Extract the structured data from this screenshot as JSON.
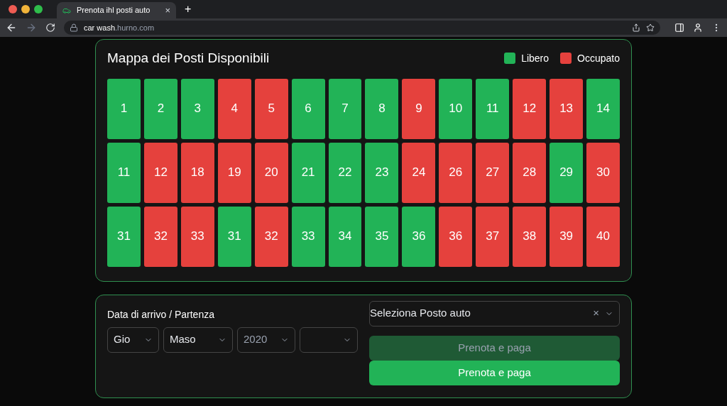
{
  "browser": {
    "tab_title": "Prenota ihl posti auto",
    "tab_close": "×",
    "new_tab": "+",
    "url_host": "car wash",
    "url_domain": ".hurno.com"
  },
  "map": {
    "title": "Mappa dei Posti Disponibili",
    "legend": [
      {
        "label": "Libero",
        "color": "#22b357"
      },
      {
        "label": "Occupato",
        "color": "#e5413d"
      }
    ],
    "rows": [
      [
        {
          "n": "1",
          "occupied": false
        },
        {
          "n": "2",
          "occupied": false
        },
        {
          "n": "3",
          "occupied": false
        },
        {
          "n": "4",
          "occupied": true
        },
        {
          "n": "5",
          "occupied": true
        },
        {
          "n": "6",
          "occupied": false
        },
        {
          "n": "7",
          "occupied": false
        },
        {
          "n": "8",
          "occupied": false
        },
        {
          "n": "9",
          "occupied": true
        },
        {
          "n": "10",
          "occupied": false
        },
        {
          "n": "11",
          "occupied": false
        },
        {
          "n": "12",
          "occupied": true
        },
        {
          "n": "13",
          "occupied": true
        },
        {
          "n": "14",
          "occupied": false
        }
      ],
      [
        {
          "n": "11",
          "occupied": false
        },
        {
          "n": "12",
          "occupied": true
        },
        {
          "n": "18",
          "occupied": true
        },
        {
          "n": "19",
          "occupied": true
        },
        {
          "n": "20",
          "occupied": true
        },
        {
          "n": "21",
          "occupied": false
        },
        {
          "n": "22",
          "occupied": false
        },
        {
          "n": "23",
          "occupied": false
        },
        {
          "n": "24",
          "occupied": true
        },
        {
          "n": "26",
          "occupied": true
        },
        {
          "n": "27",
          "occupied": true
        },
        {
          "n": "28",
          "occupied": true
        },
        {
          "n": "29",
          "occupied": false
        },
        {
          "n": "30",
          "occupied": true
        }
      ],
      [
        {
          "n": "31",
          "occupied": false
        },
        {
          "n": "32",
          "occupied": true
        },
        {
          "n": "33",
          "occupied": true
        },
        {
          "n": "31",
          "occupied": false
        },
        {
          "n": "32",
          "occupied": true
        },
        {
          "n": "33",
          "occupied": false
        },
        {
          "n": "34",
          "occupied": false
        },
        {
          "n": "35",
          "occupied": false
        },
        {
          "n": "36",
          "occupied": false
        },
        {
          "n": "36",
          "occupied": true
        },
        {
          "n": "37",
          "occupied": true
        },
        {
          "n": "38",
          "occupied": true
        },
        {
          "n": "39",
          "occupied": true
        },
        {
          "n": "40",
          "occupied": true
        }
      ]
    ]
  },
  "booking": {
    "date_label": "Data di arrivo / Partenza",
    "date_selects": [
      {
        "kind": "value",
        "text": "Gio"
      },
      {
        "kind": "value",
        "text": "Maso"
      },
      {
        "kind": "placeholder",
        "text": "2020"
      },
      {
        "kind": "blank"
      }
    ],
    "spot_select": {
      "value": "Seleziona Posto auto",
      "clear": "×"
    },
    "buttons": [
      {
        "label": "Prenota e paga",
        "disabled": true
      },
      {
        "label": "Prenota e paga",
        "disabled": false
      }
    ]
  }
}
